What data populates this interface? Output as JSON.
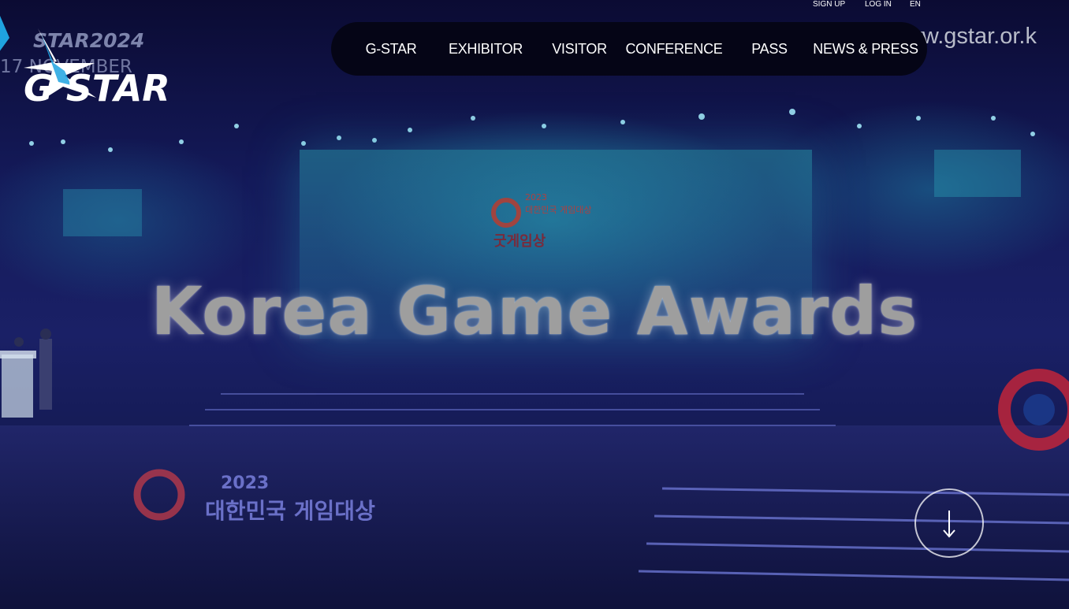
{
  "header": {
    "logo_text": "G STAR",
    "logo_overlay_text": "STAR2024",
    "logo_overlay_date": "17 NOVEMBER",
    "utility_links": [
      {
        "label": "SIGN UP"
      },
      {
        "label": "LOG IN"
      },
      {
        "label": "EN"
      }
    ],
    "nav": [
      {
        "label": "G-STAR"
      },
      {
        "label": "EXHIBITOR"
      },
      {
        "label": "VISITOR"
      },
      {
        "label": "CONFERENCE"
      },
      {
        "label": "PASS"
      },
      {
        "label": "NEWS & PRESS"
      }
    ]
  },
  "hero": {
    "headline": "Korea Game Awards",
    "watermark": "www.gstar.or.k",
    "screen_year": "2023",
    "screen_title": "대한민국 게임대상",
    "screen_subtitle": "굿게임상",
    "floor_year": "2023",
    "floor_title": "대한민국 게임대상",
    "scroll_icon": "arrow-down-icon"
  },
  "colors": {
    "nav_bg": "#050516",
    "headline": "#9e9e9e",
    "logo_accent": "#1fa3e0",
    "background": "#141a5a"
  }
}
